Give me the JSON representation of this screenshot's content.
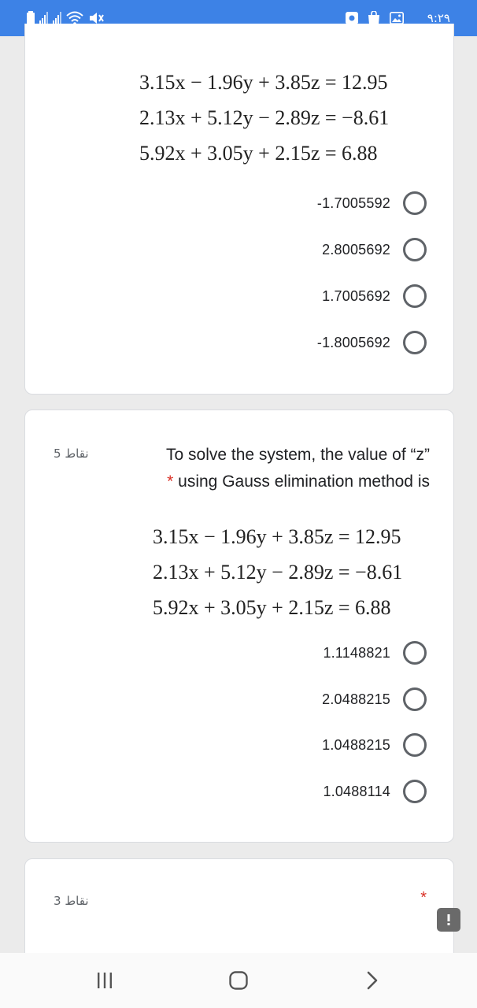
{
  "status_bar": {
    "time": "٩:٢٩",
    "icons": [
      "battery-icon",
      "signal-icon",
      "signal-icon",
      "wifi-icon",
      "mute-icon",
      "screen-record-icon",
      "shopping-bag-icon",
      "gallery-icon"
    ],
    "background": "#3d82e6"
  },
  "card1": {
    "equations": [
      "3.15x − 1.96y + 3.85z = 12.95",
      "2.13x + 5.12y − 2.89z = −8.61",
      "5.92x + 3.05y + 2.15z = 6.88"
    ],
    "options": [
      "-1.7005592",
      "2.8005692",
      "1.7005692",
      "-1.8005692"
    ]
  },
  "card2": {
    "points": "5 نقاط",
    "question_line1": "To solve the system, the value of “z”",
    "required_mark": "*",
    "question_line2": "using Gauss elimination method is",
    "equations": [
      "3.15x − 1.96y + 3.85z = 12.95",
      "2.13x + 5.12y − 2.89z = −8.61",
      "5.92x + 3.05y + 2.15z = 6.88"
    ],
    "options": [
      "1.1148821",
      "2.0488215",
      "1.0488215",
      "1.0488114"
    ]
  },
  "card3": {
    "points": "3 نقاط",
    "required_mark": "*"
  },
  "feedback_button": {
    "icon": "feedback-icon"
  },
  "nav_bar": {
    "icons": [
      "recent-apps-icon",
      "home-icon",
      "back-icon"
    ]
  }
}
